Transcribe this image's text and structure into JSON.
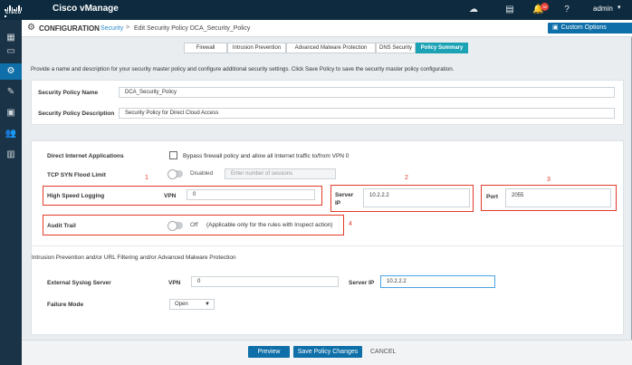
{
  "topbar": {
    "logo_text": "cisco",
    "app_title": "Cisco vManage",
    "notification_count": "38",
    "user": "admin"
  },
  "header": {
    "section": "CONFIGURATION",
    "breadcrumb_link": "Security",
    "breadcrumb_separator": ">",
    "breadcrumb_current": "Edit Security Policy DCA_Security_Policy",
    "custom_options": "Custom Options"
  },
  "tabs": [
    {
      "label": "Firewall"
    },
    {
      "label": "Intrusion Prevention"
    },
    {
      "label": "Advanced Malware Protection"
    },
    {
      "label": "DNS Security"
    },
    {
      "label": "Policy Summary"
    }
  ],
  "description": "Provide a name and description for your security master policy and configure additional security settings. Click Save Policy to save the security master policy configuration.",
  "policy": {
    "name_label": "Security Policy Name",
    "name_value": "DCA_Security_Policy",
    "desc_label": "Security Policy Description",
    "desc_value": "Security Policy for Direct Cloud Access"
  },
  "settings": {
    "dia_label": "Direct Internet Applications",
    "dia_checkbox_text": "Bypass firewall policy and allow all Internet traffic to/from VPN 0",
    "tcp_label": "TCP SYN Flood Limit",
    "tcp_toggle_text": "Disabled",
    "tcp_placeholder": "Enter number of sessions",
    "hsl_label": "High Speed Logging",
    "hsl_vpn_label": "VPN",
    "hsl_vpn_value": "0",
    "server_ip_label": "Server IP",
    "server_ip_value": "10.2.2.2",
    "port_label": "Port",
    "port_value": "2055",
    "audit_label": "Audit Trail",
    "audit_toggle_text": "Off",
    "audit_note": "(Applicable only for the rules with Inspect action)"
  },
  "annotations": {
    "n1": "1",
    "n2": "2",
    "n3": "3",
    "n4": "4"
  },
  "ips": {
    "section_title": "Intrusion Prevention and/or URL Filtering and/or Advanced Malware Protection",
    "syslog_label": "External Syslog Server",
    "vpn_label": "VPN",
    "vpn_value": "0",
    "server_ip_label": "Server IP",
    "server_ip_value": "10.2.2.2",
    "failure_label": "Failure Mode",
    "failure_value": "Open"
  },
  "footer": {
    "preview": "Preview",
    "save": "Save Policy Changes",
    "cancel": "CANCEL"
  },
  "colors": {
    "accent": "#0f6fa8",
    "tab_active": "#1ba3b5",
    "highlight": "#e23b2a",
    "topbar": "#0d2a3e"
  }
}
